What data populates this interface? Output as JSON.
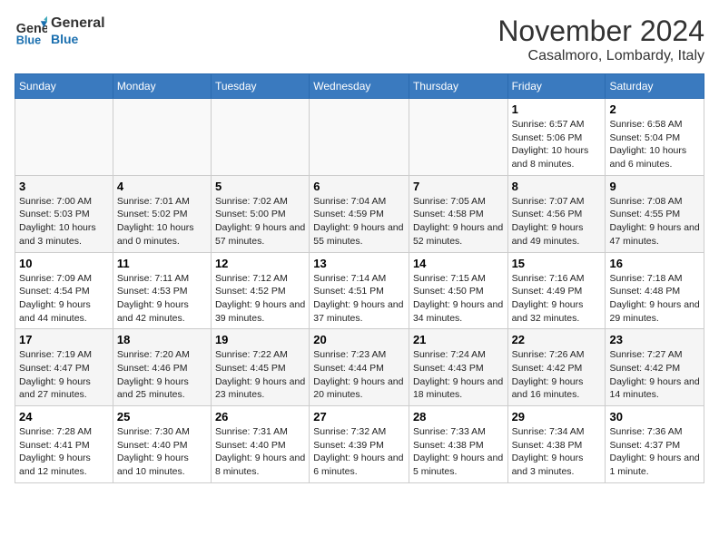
{
  "logo": {
    "line1": "General",
    "line2": "Blue"
  },
  "title": "November 2024",
  "location": "Casalmoro, Lombardy, Italy",
  "days_of_week": [
    "Sunday",
    "Monday",
    "Tuesday",
    "Wednesday",
    "Thursday",
    "Friday",
    "Saturday"
  ],
  "weeks": [
    [
      {
        "day": "",
        "info": ""
      },
      {
        "day": "",
        "info": ""
      },
      {
        "day": "",
        "info": ""
      },
      {
        "day": "",
        "info": ""
      },
      {
        "day": "",
        "info": ""
      },
      {
        "day": "1",
        "info": "Sunrise: 6:57 AM\nSunset: 5:06 PM\nDaylight: 10 hours and 8 minutes."
      },
      {
        "day": "2",
        "info": "Sunrise: 6:58 AM\nSunset: 5:04 PM\nDaylight: 10 hours and 6 minutes."
      }
    ],
    [
      {
        "day": "3",
        "info": "Sunrise: 7:00 AM\nSunset: 5:03 PM\nDaylight: 10 hours and 3 minutes."
      },
      {
        "day": "4",
        "info": "Sunrise: 7:01 AM\nSunset: 5:02 PM\nDaylight: 10 hours and 0 minutes."
      },
      {
        "day": "5",
        "info": "Sunrise: 7:02 AM\nSunset: 5:00 PM\nDaylight: 9 hours and 57 minutes."
      },
      {
        "day": "6",
        "info": "Sunrise: 7:04 AM\nSunset: 4:59 PM\nDaylight: 9 hours and 55 minutes."
      },
      {
        "day": "7",
        "info": "Sunrise: 7:05 AM\nSunset: 4:58 PM\nDaylight: 9 hours and 52 minutes."
      },
      {
        "day": "8",
        "info": "Sunrise: 7:07 AM\nSunset: 4:56 PM\nDaylight: 9 hours and 49 minutes."
      },
      {
        "day": "9",
        "info": "Sunrise: 7:08 AM\nSunset: 4:55 PM\nDaylight: 9 hours and 47 minutes."
      }
    ],
    [
      {
        "day": "10",
        "info": "Sunrise: 7:09 AM\nSunset: 4:54 PM\nDaylight: 9 hours and 44 minutes."
      },
      {
        "day": "11",
        "info": "Sunrise: 7:11 AM\nSunset: 4:53 PM\nDaylight: 9 hours and 42 minutes."
      },
      {
        "day": "12",
        "info": "Sunrise: 7:12 AM\nSunset: 4:52 PM\nDaylight: 9 hours and 39 minutes."
      },
      {
        "day": "13",
        "info": "Sunrise: 7:14 AM\nSunset: 4:51 PM\nDaylight: 9 hours and 37 minutes."
      },
      {
        "day": "14",
        "info": "Sunrise: 7:15 AM\nSunset: 4:50 PM\nDaylight: 9 hours and 34 minutes."
      },
      {
        "day": "15",
        "info": "Sunrise: 7:16 AM\nSunset: 4:49 PM\nDaylight: 9 hours and 32 minutes."
      },
      {
        "day": "16",
        "info": "Sunrise: 7:18 AM\nSunset: 4:48 PM\nDaylight: 9 hours and 29 minutes."
      }
    ],
    [
      {
        "day": "17",
        "info": "Sunrise: 7:19 AM\nSunset: 4:47 PM\nDaylight: 9 hours and 27 minutes."
      },
      {
        "day": "18",
        "info": "Sunrise: 7:20 AM\nSunset: 4:46 PM\nDaylight: 9 hours and 25 minutes."
      },
      {
        "day": "19",
        "info": "Sunrise: 7:22 AM\nSunset: 4:45 PM\nDaylight: 9 hours and 23 minutes."
      },
      {
        "day": "20",
        "info": "Sunrise: 7:23 AM\nSunset: 4:44 PM\nDaylight: 9 hours and 20 minutes."
      },
      {
        "day": "21",
        "info": "Sunrise: 7:24 AM\nSunset: 4:43 PM\nDaylight: 9 hours and 18 minutes."
      },
      {
        "day": "22",
        "info": "Sunrise: 7:26 AM\nSunset: 4:42 PM\nDaylight: 9 hours and 16 minutes."
      },
      {
        "day": "23",
        "info": "Sunrise: 7:27 AM\nSunset: 4:42 PM\nDaylight: 9 hours and 14 minutes."
      }
    ],
    [
      {
        "day": "24",
        "info": "Sunrise: 7:28 AM\nSunset: 4:41 PM\nDaylight: 9 hours and 12 minutes."
      },
      {
        "day": "25",
        "info": "Sunrise: 7:30 AM\nSunset: 4:40 PM\nDaylight: 9 hours and 10 minutes."
      },
      {
        "day": "26",
        "info": "Sunrise: 7:31 AM\nSunset: 4:40 PM\nDaylight: 9 hours and 8 minutes."
      },
      {
        "day": "27",
        "info": "Sunrise: 7:32 AM\nSunset: 4:39 PM\nDaylight: 9 hours and 6 minutes."
      },
      {
        "day": "28",
        "info": "Sunrise: 7:33 AM\nSunset: 4:38 PM\nDaylight: 9 hours and 5 minutes."
      },
      {
        "day": "29",
        "info": "Sunrise: 7:34 AM\nSunset: 4:38 PM\nDaylight: 9 hours and 3 minutes."
      },
      {
        "day": "30",
        "info": "Sunrise: 7:36 AM\nSunset: 4:37 PM\nDaylight: 9 hours and 1 minute."
      }
    ]
  ]
}
